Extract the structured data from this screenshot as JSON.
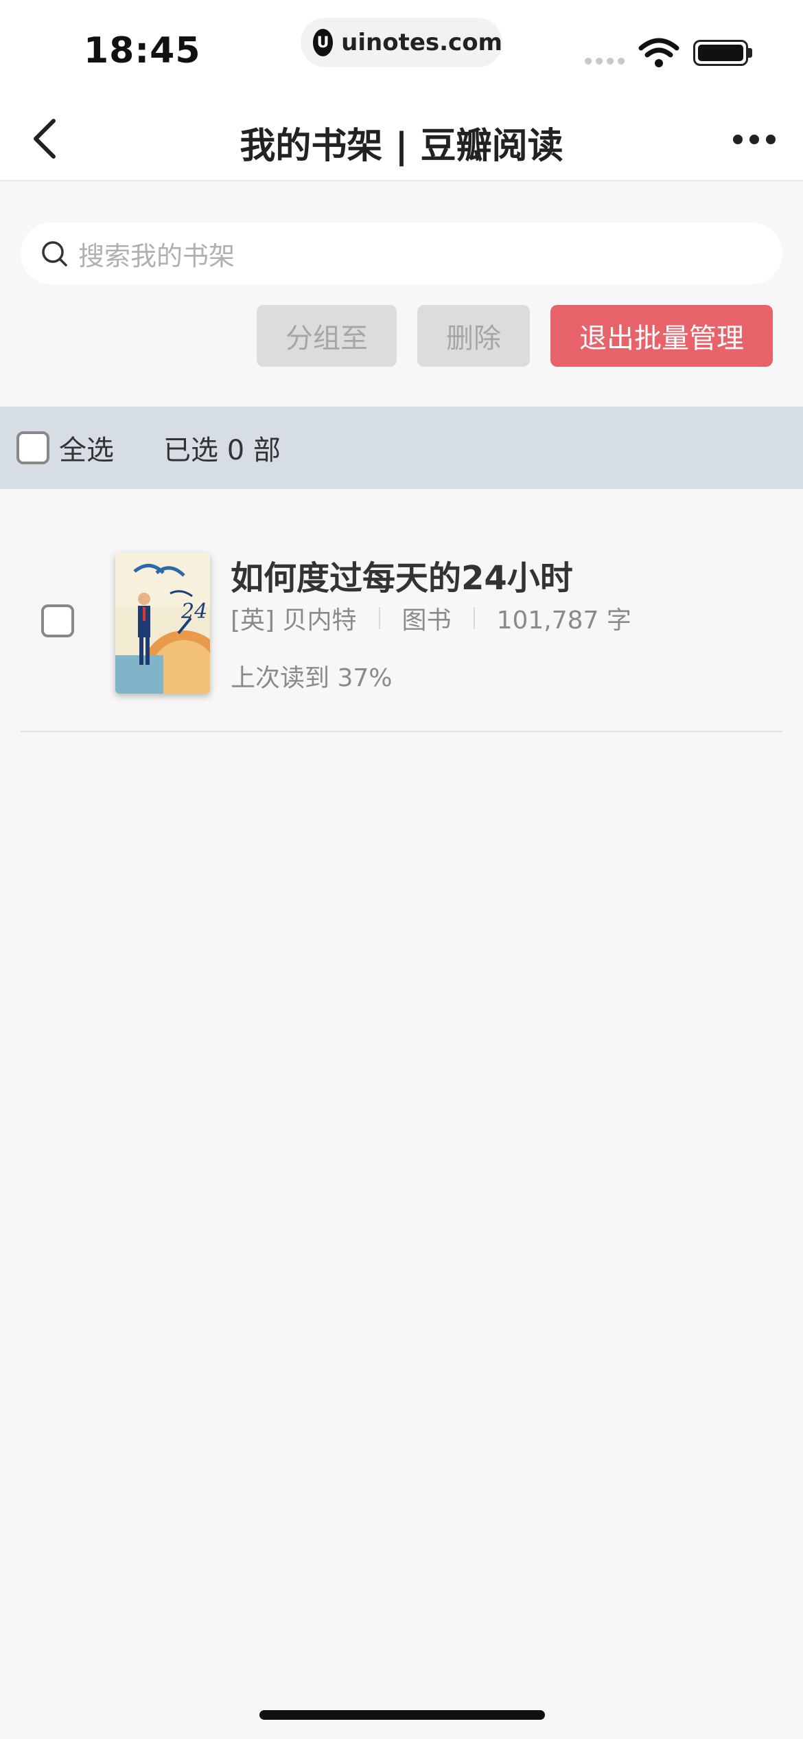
{
  "status_bar": {
    "time": "18:45",
    "site": "uinotes.com"
  },
  "nav": {
    "title": "我的书架 | 豆瓣阅读"
  },
  "search": {
    "placeholder": "搜索我的书架"
  },
  "actions": {
    "group_label": "分组至",
    "delete_label": "删除",
    "exit_label": "退出批量管理"
  },
  "selection": {
    "select_all_label": "全选",
    "selected_text": "已选 0 部"
  },
  "books": [
    {
      "title": "如何度过每天的24小时",
      "author": "[英] 贝内特",
      "type": "图书",
      "word_count": "101,787 字",
      "progress": "上次读到 37%"
    }
  ],
  "colors": {
    "accent": "#e8626a",
    "disabled_button": "#dcdcdc",
    "select_bar": "#d6dde4"
  }
}
